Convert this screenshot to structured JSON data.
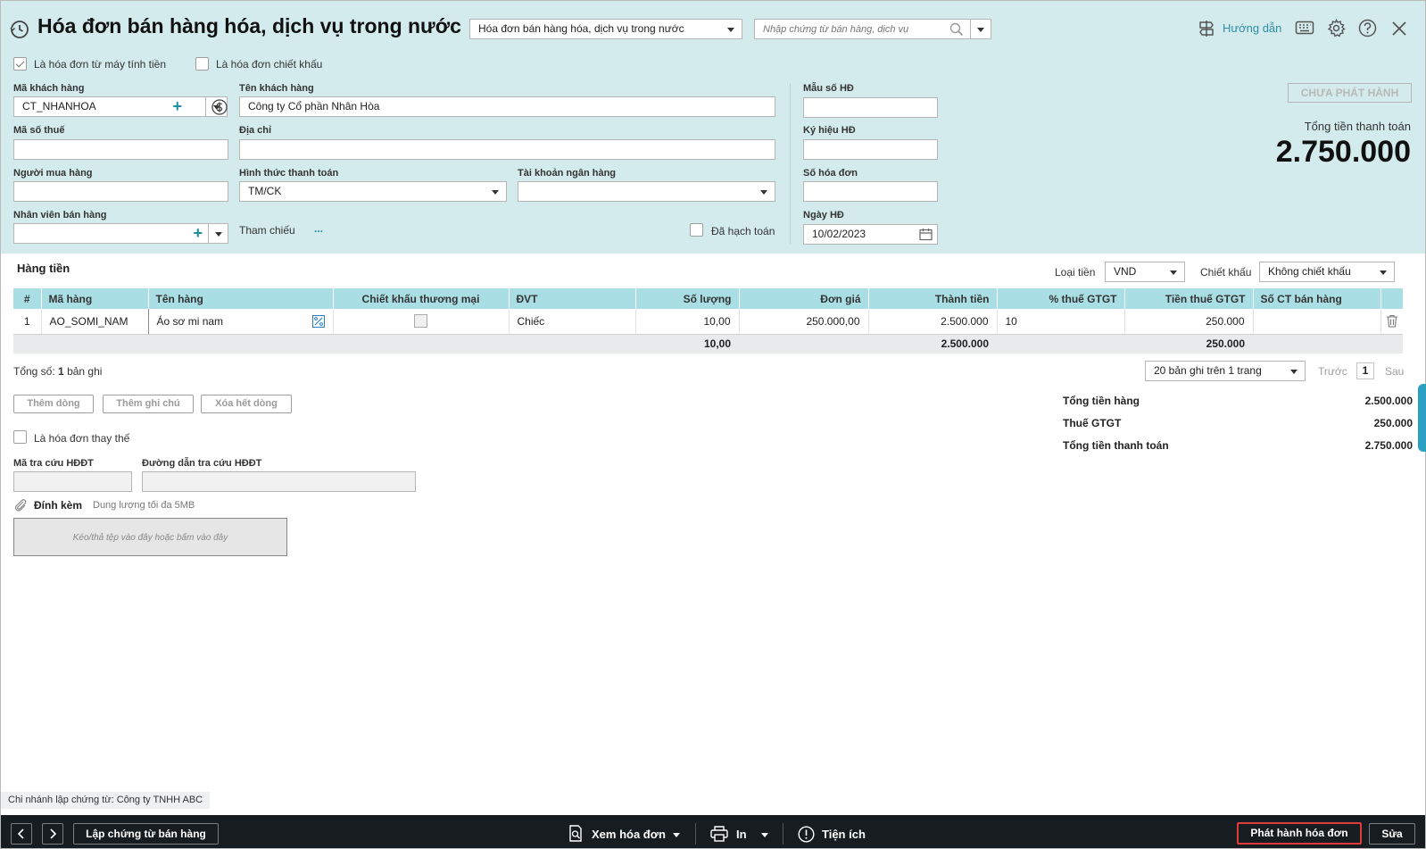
{
  "header": {
    "title": "Hóa đơn bán hàng hóa, dịch vụ trong nước",
    "type_select": "Hóa đơn bán hàng hóa, dịch vụ trong nước",
    "search_placeholder": "Nhập chứng từ bán hàng, dịch vụ",
    "guide_label": "Hướng dẫn"
  },
  "options": {
    "cash_register_label": "Là hóa đơn từ máy tính tiền",
    "cash_register_checked": true,
    "discount_invoice_label": "Là hóa đơn chiết khấu",
    "discount_invoice_checked": false
  },
  "form": {
    "customer_code_label": "Mã khách hàng",
    "customer_code": "CT_NHANHOA",
    "customer_name_label": "Tên khách hàng",
    "customer_name": "Công ty Cổ phần Nhân Hòa",
    "tax_code_label": "Mã số thuế",
    "tax_code": "",
    "address_label": "Địa chỉ",
    "address": "",
    "buyer_label": "Người mua hàng",
    "buyer": "",
    "payment_label": "Hình thức thanh toán",
    "payment": "TM/CK",
    "bank_label": "Tài khoản ngân hàng",
    "bank": "",
    "salesperson_label": "Nhân viên bán hàng",
    "salesperson": "",
    "reference_label": "Tham chiếu",
    "reference_more": "...",
    "posted_label": "Đã hạch toán",
    "posted_checked": false,
    "template_label": "Mẫu số HĐ",
    "template": "",
    "symbol_label": "Ký hiệu HĐ",
    "symbol": "",
    "invoice_no_label": "Số hóa đơn",
    "invoice_no": "",
    "invoice_date_label": "Ngày HĐ",
    "invoice_date": "10/02/2023"
  },
  "status": {
    "badge": "CHƯA PHÁT HÀNH",
    "total_label": "Tổng tiền thanh toán",
    "total": "2.750.000"
  },
  "items": {
    "section_title": "Hàng tiền",
    "currency_label": "Loại tiền",
    "currency": "VND",
    "discount_label": "Chiết khấu",
    "discount": "Không chiết khấu",
    "columns": [
      "#",
      "Mã hàng",
      "Tên hàng",
      "Chiết khấu thương mại",
      "ĐVT",
      "Số lượng",
      "Đơn giá",
      "Thành tiền",
      "% thuế GTGT",
      "Tiền thuế GTGT",
      "Số CT bán hàng"
    ],
    "rows": [
      {
        "no": "1",
        "code": "AO_SOMI_NAM",
        "name": "Áo sơ mi nam",
        "trade_discount": false,
        "unit": "Chiếc",
        "qty": "10,00",
        "price": "250.000,00",
        "amount": "2.500.000",
        "vat_rate": "10",
        "vat": "250.000",
        "sales_doc": ""
      }
    ],
    "totals": {
      "qty": "10,00",
      "amount": "2.500.000",
      "vat": "250.000"
    },
    "record_prefix": "Tổng số:",
    "record_count": "1",
    "record_suffix": "bản ghi",
    "page_size": "20 bản ghi trên 1 trang",
    "prev": "Trước",
    "page": "1",
    "next": "Sau"
  },
  "actions": {
    "add_row": "Thêm dòng",
    "add_note": "Thêm ghi chú",
    "delete_all": "Xóa hết dòng"
  },
  "summary": {
    "goods_label": "Tổng tiền hàng",
    "goods": "2.500.000",
    "vat_label": "Thuế GTGT",
    "vat": "250.000",
    "total_label": "Tổng tiền thanh toán",
    "total": "2.750.000"
  },
  "extra": {
    "replacement_label": "Là hóa đơn thay thế",
    "replacement_checked": false,
    "lookup_code_label": "Mã tra cứu HĐĐT",
    "lookup_code": "",
    "lookup_url_label": "Đường dẫn tra cứu HĐĐT",
    "lookup_url": "",
    "attach_label": "Đính kèm",
    "attach_hint": "Dung lượng tối đa 5MB",
    "drop_hint": "Kéo/thả tệp vào đây hoặc bấm vào đây"
  },
  "branch": "Chi nhánh lập chứng từ: Công ty TNHH ABC",
  "footer": {
    "create_sales_doc": "Lập chứng từ bán hàng",
    "view_invoice": "Xem hóa đơn",
    "print": "In",
    "utilities": "Tiện ích",
    "issue_invoice": "Phát hành hóa đơn",
    "edit": "Sửa"
  },
  "colors": {
    "header_bg": "#d4ebee",
    "grid_header_bg": "#a9dfe4",
    "accent": "#2d8fa4",
    "footer_bg": "#171c20",
    "issue_highlight": "#e03a3a"
  }
}
